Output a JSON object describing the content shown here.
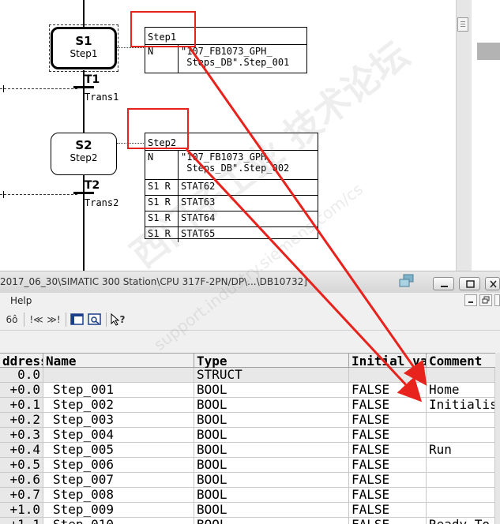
{
  "graph": {
    "steps": [
      {
        "num": "S1",
        "name": "Step1"
      },
      {
        "num": "S2",
        "name": "Step2"
      }
    ],
    "transitions": [
      {
        "num": "T1",
        "name": "Trans1"
      },
      {
        "num": "T2",
        "name": "Trans2"
      }
    ],
    "action_box_1": {
      "header": "Step1",
      "rows": [
        {
          "qualifier": "N",
          "value": "\"107_FB1073_GPH_\n Steps_DB\".Step_001"
        }
      ]
    },
    "action_box_2": {
      "header": "Step2",
      "rows": [
        {
          "qualifier": "N",
          "value": "\"107_FB1073_GPH_\n Steps_DB\".Step_002"
        },
        {
          "qualifier": "S1 R",
          "value": "STAT62"
        },
        {
          "qualifier": "S1 R",
          "value": "STAT63"
        },
        {
          "qualifier": "S1 R",
          "value": "STAT64"
        },
        {
          "qualifier": "S1 R",
          "value": "STAT65"
        }
      ]
    }
  },
  "db_window": {
    "title": "2017_06_30\\SIMATIC 300 Station\\CPU 317F-2PN/DP\\...\\DB10732]",
    "menu": {
      "help": "Help"
    },
    "toolbar": {
      "glasses": "6ô",
      "nav_prev": "!≪",
      "nav_next": "≫!",
      "help_q": "?"
    },
    "columns": {
      "address": "ddress",
      "name": "Name",
      "type": "Type",
      "initial": "Initial value",
      "comment": "Comment"
    },
    "rows": [
      {
        "address": "0.0",
        "name": "",
        "type": "STRUCT",
        "initial": "",
        "comment": ""
      },
      {
        "address": "+0.0",
        "name": "Step_001",
        "type": "BOOL",
        "initial": "FALSE",
        "comment": "Home"
      },
      {
        "address": "+0.1",
        "name": "Step_002",
        "type": "BOOL",
        "initial": "FALSE",
        "comment": "Initialise"
      },
      {
        "address": "+0.2",
        "name": "Step_003",
        "type": "BOOL",
        "initial": "FALSE",
        "comment": ""
      },
      {
        "address": "+0.3",
        "name": "Step_004",
        "type": "BOOL",
        "initial": "FALSE",
        "comment": ""
      },
      {
        "address": "+0.4",
        "name": "Step_005",
        "type": "BOOL",
        "initial": "FALSE",
        "comment": "Run"
      },
      {
        "address": "+0.5",
        "name": "Step_006",
        "type": "BOOL",
        "initial": "FALSE",
        "comment": ""
      },
      {
        "address": "+0.6",
        "name": "Step_007",
        "type": "BOOL",
        "initial": "FALSE",
        "comment": ""
      },
      {
        "address": "+0.7",
        "name": "Step_008",
        "type": "BOOL",
        "initial": "FALSE",
        "comment": ""
      },
      {
        "address": "+1.0",
        "name": "Step_009",
        "type": "BOOL",
        "initial": "FALSE",
        "comment": ""
      },
      {
        "address": "+1.1",
        "name": "Step_010",
        "type": "BOOL",
        "initial": "FALSE",
        "comment": "Ready To I"
      }
    ]
  },
  "watermark": {
    "line1": "西门子工业 技术论坛",
    "line2": "support.industry.siemens.com/cs"
  },
  "colors": {
    "annotation_red": "#e8221c",
    "window_bg": "#ece9d8",
    "header_bg": "#f0f0f0"
  }
}
